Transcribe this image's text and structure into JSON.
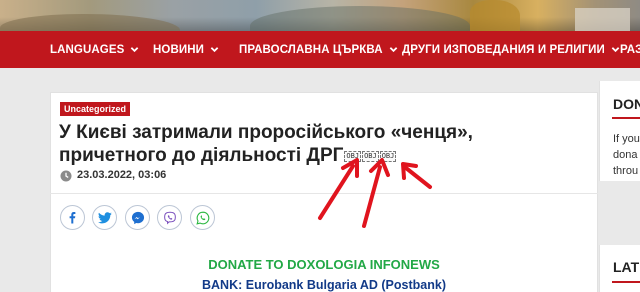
{
  "header": {
    "photo": "landscape-photo"
  },
  "nav": {
    "items": [
      {
        "label": "LANGUAGES",
        "has_dropdown": true
      },
      {
        "label": "НОВИНИ",
        "has_dropdown": true
      },
      {
        "label": "ПРАВОСЛАВНА ЦЪРКВА",
        "has_dropdown": true
      },
      {
        "label": "ДРУГИ ИЗПОВЕДАНИЯ И РЕЛИГИИ",
        "has_dropdown": true
      },
      {
        "label": "РАЗ",
        "has_dropdown": false
      }
    ]
  },
  "article": {
    "category": "Uncategorized",
    "title_line1": "У Києві затримали проросійського «ченця»,",
    "title_line2": "причетного до діяльності ДРГ",
    "obj_markers": [
      "OBJ",
      "OBJ",
      "OBJ"
    ],
    "date": "23.03.2022, 03:06",
    "share_icons": [
      "facebook-icon",
      "twitter-icon",
      "messenger-icon",
      "viber-icon",
      "whatsapp-icon"
    ],
    "donate_title": "DONATE TO DOXOLOGIA INFONEWS",
    "bank_line": "BANK: Eurobank Bulgaria AD (Postbank)"
  },
  "sidebar": {
    "donate_heading": "DON",
    "donate_text_lines": [
      "If you",
      "dona",
      "throu"
    ],
    "latest_heading": "LAT"
  },
  "colors": {
    "brand_red": "#c0171d",
    "donate_green": "#22a846",
    "bank_blue": "#123a88",
    "share_blue": "#1e6fd0",
    "whatsapp_green": "#2bb741",
    "viber_purple": "#7a4fbd",
    "annotation_red": "#e0141e"
  }
}
